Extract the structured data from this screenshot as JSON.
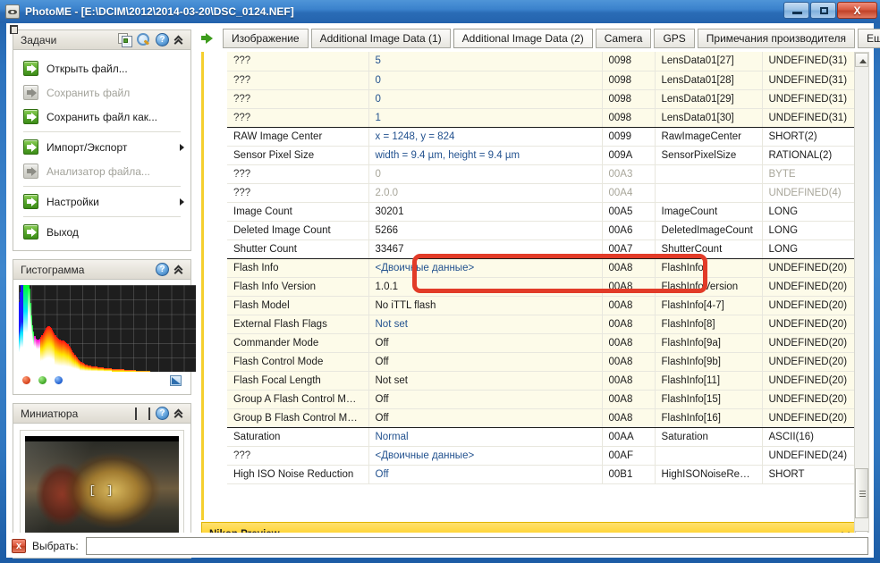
{
  "window": {
    "title": "PhotoME - [E:\\DCIM\\2012\\2014-03-20\\DSC_0124.NEF]",
    "minimize_label": "",
    "maximize_label": "",
    "close_label": "X"
  },
  "sidebar": {
    "tasks_panel": {
      "title": "Задачи",
      "icons": [
        "copy-icon",
        "search-icon",
        "help-icon",
        "collapse-icon"
      ],
      "items": [
        {
          "label": "Открыть файл...",
          "enabled": true,
          "submenu": false
        },
        {
          "label": "Сохранить файл",
          "enabled": false,
          "submenu": false
        },
        {
          "label": "Сохранить файл как...",
          "enabled": true,
          "submenu": false
        },
        {
          "label": "Импорт/Экспорт",
          "enabled": true,
          "submenu": true
        },
        {
          "label": "Анализатор файла...",
          "enabled": false,
          "submenu": false
        },
        {
          "label": "Настройки",
          "enabled": true,
          "submenu": true
        },
        {
          "label": "Выход",
          "enabled": true,
          "submenu": false
        }
      ]
    },
    "histogram_panel": {
      "title": "Гистограмма",
      "icons": [
        "help-icon",
        "collapse-icon"
      ],
      "channel_dots": [
        "red",
        "green",
        "blue"
      ],
      "mode_icon": "histogram-mode-icon"
    },
    "thumbnail_panel": {
      "title": "Миниатюра",
      "icons": [
        "thumbnail-mode-icon",
        "help-icon",
        "collapse-icon"
      ],
      "focus_marker": "[ ]"
    }
  },
  "main": {
    "tabs": [
      {
        "label": "Изображение",
        "active": false
      },
      {
        "label": "Additional Image Data (1)",
        "active": false
      },
      {
        "label": "Additional Image Data (2)",
        "active": true
      },
      {
        "label": "Camera",
        "active": false
      },
      {
        "label": "GPS",
        "active": false
      },
      {
        "label": "Примечания производителя",
        "active": false
      },
      {
        "label": "Еще...",
        "active": false
      }
    ],
    "toolbar_icons": [
      "image-viewer-icon",
      "photoshop-icon"
    ],
    "table": {
      "rows": [
        {
          "name": "???",
          "value": "5",
          "hex": "0098",
          "tag": "LensData01[27]",
          "type": "UNDEFINED(31)",
          "link": true,
          "alt": true,
          "dim": false,
          "group_end": false
        },
        {
          "name": "???",
          "value": "0",
          "hex": "0098",
          "tag": "LensData01[28]",
          "type": "UNDEFINED(31)",
          "link": true,
          "alt": true,
          "dim": false,
          "group_end": false
        },
        {
          "name": "???",
          "value": "0",
          "hex": "0098",
          "tag": "LensData01[29]",
          "type": "UNDEFINED(31)",
          "link": true,
          "alt": true,
          "dim": false,
          "group_end": false
        },
        {
          "name": "???",
          "value": "1",
          "hex": "0098",
          "tag": "LensData01[30]",
          "type": "UNDEFINED(31)",
          "link": true,
          "alt": true,
          "dim": false,
          "group_end": true
        },
        {
          "name": "RAW Image Center",
          "value": "x = 1248, y = 824",
          "hex": "0099",
          "tag": "RawImageCenter",
          "type": "SHORT(2)",
          "link": true,
          "alt": false,
          "dim": false,
          "group_end": false
        },
        {
          "name": "Sensor Pixel Size",
          "value": "width = 9.4 µm, height = 9.4 µm",
          "hex": "009A",
          "tag": "SensorPixelSize",
          "type": "RATIONAL(2)",
          "link": true,
          "alt": false,
          "dim": false,
          "group_end": false
        },
        {
          "name": "???",
          "value": "0",
          "hex": "00A3",
          "tag": "",
          "type": "BYTE",
          "link": false,
          "alt": false,
          "dim": true,
          "group_end": false
        },
        {
          "name": "???",
          "value": "2.0.0",
          "hex": "00A4",
          "tag": "",
          "type": "UNDEFINED(4)",
          "link": false,
          "alt": false,
          "dim": true,
          "group_end": false
        },
        {
          "name": "Image Count",
          "value": "30201",
          "hex": "00A5",
          "tag": "ImageCount",
          "type": "LONG",
          "link": false,
          "alt": false,
          "dim": false,
          "group_end": false
        },
        {
          "name": "Deleted Image Count",
          "value": "5266",
          "hex": "00A6",
          "tag": "DeletedImageCount",
          "type": "LONG",
          "link": false,
          "alt": false,
          "dim": false,
          "group_end": false
        },
        {
          "name": "Shutter Count",
          "value": "33467",
          "hex": "00A7",
          "tag": "ShutterCount",
          "type": "LONG",
          "link": false,
          "alt": false,
          "dim": false,
          "group_end": true
        },
        {
          "name": "Flash Info",
          "value": "<Двоичные данные>",
          "hex": "00A8",
          "tag": "FlashInfo",
          "type": "UNDEFINED(20)",
          "link": true,
          "alt": true,
          "dim": false,
          "group_end": false
        },
        {
          "name": "Flash Info Version",
          "value": "1.0.1",
          "hex": "00A8",
          "tag": "FlashInfoVersion",
          "type": "UNDEFINED(20)",
          "link": false,
          "alt": true,
          "dim": false,
          "group_end": false
        },
        {
          "name": "Flash Model",
          "value": "No iTTL flash",
          "hex": "00A8",
          "tag": "FlashInfo[4-7]",
          "type": "UNDEFINED(20)",
          "link": false,
          "alt": true,
          "dim": false,
          "group_end": false
        },
        {
          "name": "External Flash Flags",
          "value": "Not set",
          "hex": "00A8",
          "tag": "FlashInfo[8]",
          "type": "UNDEFINED(20)",
          "link": true,
          "alt": true,
          "dim": false,
          "group_end": false
        },
        {
          "name": "Commander Mode",
          "value": "Off",
          "hex": "00A8",
          "tag": "FlashInfo[9a]",
          "type": "UNDEFINED(20)",
          "link": false,
          "alt": true,
          "dim": false,
          "group_end": false
        },
        {
          "name": "Flash Control Mode",
          "value": "Off",
          "hex": "00A8",
          "tag": "FlashInfo[9b]",
          "type": "UNDEFINED(20)",
          "link": false,
          "alt": true,
          "dim": false,
          "group_end": false
        },
        {
          "name": "Flash Focal Length",
          "value": "Not set",
          "hex": "00A8",
          "tag": "FlashInfo[11]",
          "type": "UNDEFINED(20)",
          "link": false,
          "alt": true,
          "dim": false,
          "group_end": false
        },
        {
          "name": "Group A Flash Control Mode",
          "value": "Off",
          "hex": "00A8",
          "tag": "FlashInfo[15]",
          "type": "UNDEFINED(20)",
          "link": false,
          "alt": true,
          "dim": false,
          "group_end": false
        },
        {
          "name": "Group B Flash Control Mode",
          "value": "Off",
          "hex": "00A8",
          "tag": "FlashInfo[16]",
          "type": "UNDEFINED(20)",
          "link": false,
          "alt": true,
          "dim": false,
          "group_end": true
        },
        {
          "name": "Saturation",
          "value": "Normal",
          "hex": "00AA",
          "tag": "Saturation",
          "type": "ASCII(16)",
          "link": true,
          "alt": false,
          "dim": false,
          "group_end": false
        },
        {
          "name": "???",
          "value": "<Двоичные данные>",
          "hex": "00AF",
          "tag": "",
          "type": "UNDEFINED(24)",
          "link": true,
          "alt": false,
          "dim": false,
          "group_end": false
        },
        {
          "name": "High ISO Noise Reduction",
          "value": "Off",
          "hex": "00B1",
          "tag": "HighISONoiseRedu...",
          "type": "SHORT",
          "link": true,
          "alt": false,
          "dim": false,
          "group_end": false
        }
      ]
    },
    "preview_bar": {
      "label": "Nikon Preview",
      "expand_icon": "chevron-double-down-icon"
    }
  },
  "status_bar": {
    "close_icon": "close-red-icon",
    "label": "Выбрать:",
    "input_value": "",
    "input_placeholder": ""
  },
  "colors": {
    "accent_yellow": "#f5cf2e",
    "annotation_red": "#e23b28",
    "row_alt": "#fdfbe9",
    "link_blue": "#23528f",
    "title_blue": "#2a6cb6"
  }
}
